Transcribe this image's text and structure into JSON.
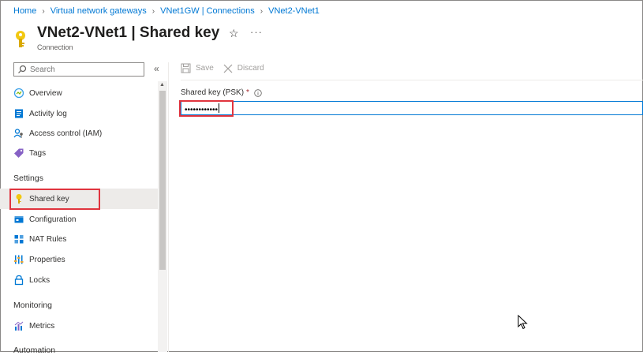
{
  "breadcrumb": {
    "items": [
      "Home",
      "Virtual network gateways",
      "VNet1GW | Connections",
      "VNet2-VNet1"
    ]
  },
  "header": {
    "title": "VNet2-VNet1 | Shared key",
    "subtitle": "Connection",
    "more": "···"
  },
  "sidebar": {
    "search_placeholder": "Search",
    "collapse_icon": "«",
    "items": [
      {
        "label": "Overview",
        "icon": "overview-icon"
      },
      {
        "label": "Activity log",
        "icon": "activity-log-icon"
      },
      {
        "label": "Access control (IAM)",
        "icon": "iam-icon"
      },
      {
        "label": "Tags",
        "icon": "tag-icon"
      }
    ],
    "settings_header": "Settings",
    "settings_items": [
      {
        "label": "Shared key",
        "icon": "key-icon",
        "active": true
      },
      {
        "label": "Configuration",
        "icon": "configuration-icon"
      },
      {
        "label": "NAT Rules",
        "icon": "nat-rules-icon"
      },
      {
        "label": "Properties",
        "icon": "properties-icon"
      },
      {
        "label": "Locks",
        "icon": "lock-icon"
      }
    ],
    "monitoring_header": "Monitoring",
    "monitoring_items": [
      {
        "label": "Metrics",
        "icon": "metrics-icon"
      }
    ],
    "automation_header": "Automation"
  },
  "toolbar": {
    "save_label": "Save",
    "discard_label": "Discard"
  },
  "form": {
    "psk_label": "Shared key (PSK)",
    "required_mark": "*",
    "psk_value": "••••••••••••"
  },
  "colors": {
    "accent": "#0078d4",
    "highlight": "#e0343e",
    "key_yellow": "#f2c811"
  }
}
